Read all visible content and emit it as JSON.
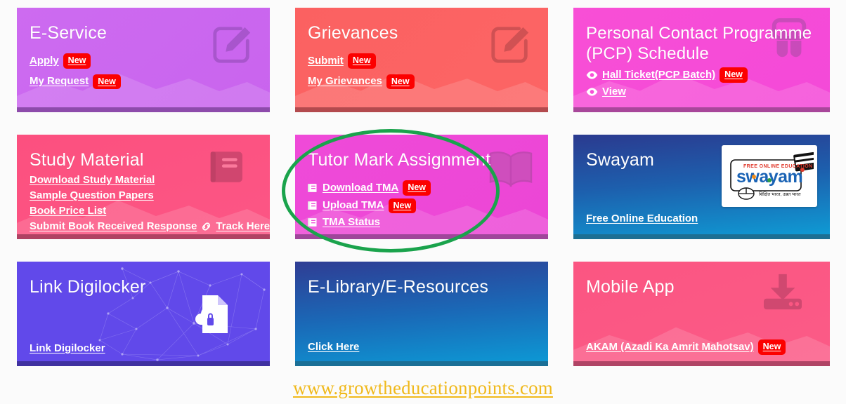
{
  "colors": {
    "badge_red": "#fc0000",
    "highlight_green": "#1aa34c",
    "footer_gold": "#f0b91b",
    "eservice": "#cd6bf0",
    "grievances": "#fb6161",
    "pcp": "#f84fd6",
    "study_material": "#fc507f",
    "tma": "#ef4ad8",
    "swayam": "#1d5fad",
    "digilocker": "#6149ea",
    "elibrary": "#1a69b7",
    "mobile_app": "#fb5582"
  },
  "badge_new": "New",
  "tiles": [
    {
      "id": "e-service",
      "title": "E-Service",
      "icon": "edit-square-icon",
      "links": [
        {
          "label": "Apply",
          "badge": "New",
          "icon": null
        },
        {
          "label": "My Request",
          "badge": "New",
          "icon": null
        }
      ]
    },
    {
      "id": "grievances",
      "title": "Grievances",
      "icon": "edit-square-icon",
      "links": [
        {
          "label": "Submit",
          "badge": "New",
          "icon": null
        },
        {
          "label": "My Grievances",
          "badge": "New",
          "icon": null
        }
      ]
    },
    {
      "id": "pcp-schedule",
      "title": "Personal Contact Programme (PCP) Schedule",
      "icon": "people-group-icon",
      "links": [
        {
          "label": "Hall Ticket(PCP Batch)",
          "badge": "New",
          "icon": "eye-icon"
        },
        {
          "label": "View",
          "badge": null,
          "icon": "eye-icon"
        }
      ]
    },
    {
      "id": "study-material",
      "title": "Study Material",
      "icon": "book-stack-icon",
      "links": [
        {
          "label": "Download Study Material",
          "badge": null,
          "icon": null
        },
        {
          "label": "Sample Question Papers",
          "badge": null,
          "icon": null
        },
        {
          "label": "Book Price List",
          "badge": null,
          "icon": null
        },
        {
          "label": "Submit Book Received Response",
          "badge": null,
          "icon": null
        },
        {
          "label": "Track Here",
          "badge": null,
          "icon": "chain-link-icon"
        }
      ]
    },
    {
      "id": "tutor-mark-assignment",
      "title": "Tutor Mark Assignment",
      "icon": "open-book-icon",
      "links": [
        {
          "label": "Download TMA",
          "badge": "New",
          "icon": "book-icon"
        },
        {
          "label": "Upload TMA",
          "badge": "New",
          "icon": "book-icon"
        },
        {
          "label": "TMA Status",
          "badge": null,
          "icon": "book-icon"
        }
      ]
    },
    {
      "id": "swayam",
      "title": "Swayam",
      "icon": "swayam-logo",
      "logo": {
        "tagline": "FREE ONLINE EDUCATION",
        "wordmark": "swayam",
        "subtitle": "शिक्षित भारत, उन्नत भारत"
      },
      "links": [
        {
          "label": "Free Online Education",
          "badge": null,
          "icon": null
        }
      ]
    },
    {
      "id": "link-digilocker",
      "title": "Link Digilocker",
      "icon": "document-cloud-lock-icon",
      "links": [
        {
          "label": "Link Digilocker",
          "badge": null,
          "icon": null
        }
      ]
    },
    {
      "id": "e-library",
      "title": "E-Library/E-Resources",
      "icon": null,
      "links": [
        {
          "label": "Click Here",
          "badge": null,
          "icon": null
        }
      ]
    },
    {
      "id": "mobile-app",
      "title": "Mobile App",
      "icon": "download-icon",
      "links": [
        {
          "label": "AKAM (Azadi Ka Amrit Mahotsav)",
          "badge": "New",
          "icon": null
        }
      ]
    }
  ],
  "footer": {
    "watermark": "www.growtheducationpoints.com"
  }
}
